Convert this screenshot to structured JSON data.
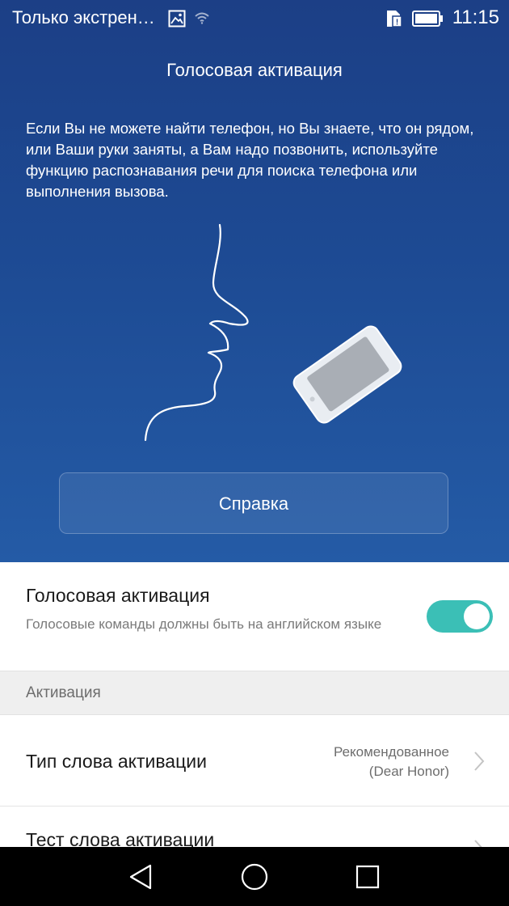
{
  "status_bar": {
    "carrier_text": "Только экстрен…",
    "time": "11:15",
    "icons": [
      "image-icon",
      "wifi-icon",
      "sim-icon",
      "battery-icon"
    ]
  },
  "hero": {
    "title": "Голосовая активация",
    "description": "Если Вы не можете найти телефон, но Вы знаете, что он рядом, или Ваши руки заняты, а Вам надо позвонить, используйте функцию распознавания речи для поиска телефона или выполнения вызова.",
    "help_button_label": "Справка",
    "illustration_icons": [
      "face-profile-icon",
      "phone-icon"
    ]
  },
  "voice_activation": {
    "title": "Голосовая активация",
    "summary": "Голосовые команды должны быть на английском языке",
    "enabled": true
  },
  "section": {
    "label": "Активация"
  },
  "items": [
    {
      "label": "Тип слова активации",
      "value_line1": "Рекомендованное",
      "value_line2": "(Dear Honor)"
    },
    {
      "label": "Тест слова активации"
    }
  ],
  "nav_bar": {
    "buttons": [
      "back-icon",
      "home-icon",
      "recents-icon"
    ]
  },
  "colors": {
    "hero_top": "#1c3f86",
    "hero_bottom": "#245ba6",
    "toggle_on": "#3bbfb6",
    "section_bg": "#efefef"
  }
}
